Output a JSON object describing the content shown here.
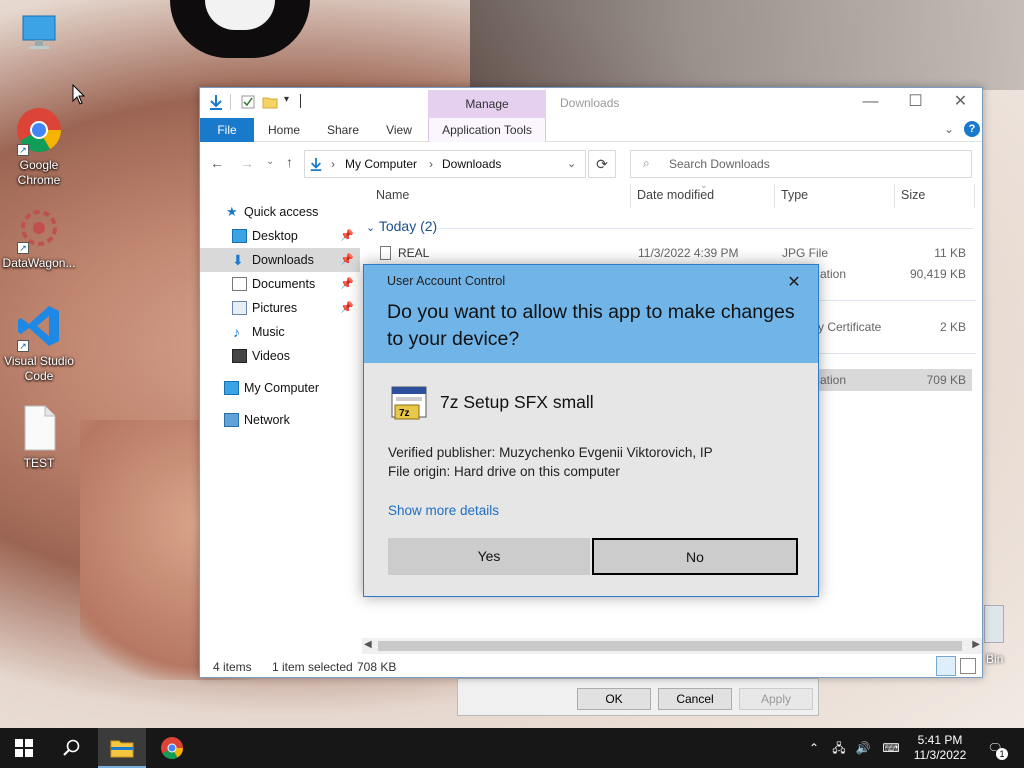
{
  "desktop": {
    "icons": [
      {
        "name": "this-pc-icon",
        "label": ""
      },
      {
        "name": "google-chrome-icon",
        "label": "Google Chrome"
      },
      {
        "name": "datawagon-icon",
        "label": "DataWagon..."
      },
      {
        "name": "visual-studio-code-icon",
        "label": "Visual Studio Code"
      },
      {
        "name": "text-file-icon",
        "label": "TEST"
      },
      {
        "name": "recycle-bin-icon",
        "label": "Bin"
      }
    ]
  },
  "explorer": {
    "title": "Downloads",
    "manage_tab": "Manage",
    "ribbon_tabs": [
      "File",
      "Home",
      "Share",
      "View",
      "Application Tools"
    ],
    "address": {
      "root": "My Computer",
      "current": "Downloads"
    },
    "search_placeholder": "Search Downloads",
    "nav": [
      {
        "label": "Quick access",
        "pinned": false
      },
      {
        "label": "Desktop",
        "pinned": true
      },
      {
        "label": "Downloads",
        "pinned": true
      },
      {
        "label": "Documents",
        "pinned": true
      },
      {
        "label": "Pictures",
        "pinned": true
      },
      {
        "label": "Music",
        "pinned": false
      },
      {
        "label": "Videos",
        "pinned": false
      },
      {
        "label": "My Computer",
        "pinned": false
      },
      {
        "label": "Network",
        "pinned": false
      }
    ],
    "columns": [
      "Name",
      "Date modified",
      "Type",
      "Size"
    ],
    "group": "Today (2)",
    "rows": [
      {
        "name": "REAL",
        "date": "11/3/2022 4:39 PM",
        "type": "JPG File",
        "size": "11 KB"
      },
      {
        "name": "",
        "date": "",
        "type": "ation",
        "size": "90,419 KB"
      },
      {
        "name": "",
        "date": "",
        "type": "y Certificate",
        "size": "2 KB"
      },
      {
        "name": "",
        "date": "",
        "type": "ation",
        "size": "709 KB"
      }
    ],
    "status": {
      "items": "4 items",
      "selected": "1 item selected",
      "size": "708 KB"
    }
  },
  "properties": {
    "ok": "OK",
    "cancel": "Cancel",
    "apply": "Apply"
  },
  "uac": {
    "title": "User Account Control",
    "question": "Do you want to allow this app to make changes to your device?",
    "app_name": "7z Setup SFX small",
    "publisher": "Verified publisher: Muzychenko Evgenii Viktorovich, IP",
    "origin": "File origin: Hard drive on this computer",
    "more": "Show more details",
    "yes": "Yes",
    "no": "No",
    "close": "✕"
  },
  "taskbar": {
    "time": "5:41 PM",
    "date": "11/3/2022",
    "notifications": "1"
  }
}
